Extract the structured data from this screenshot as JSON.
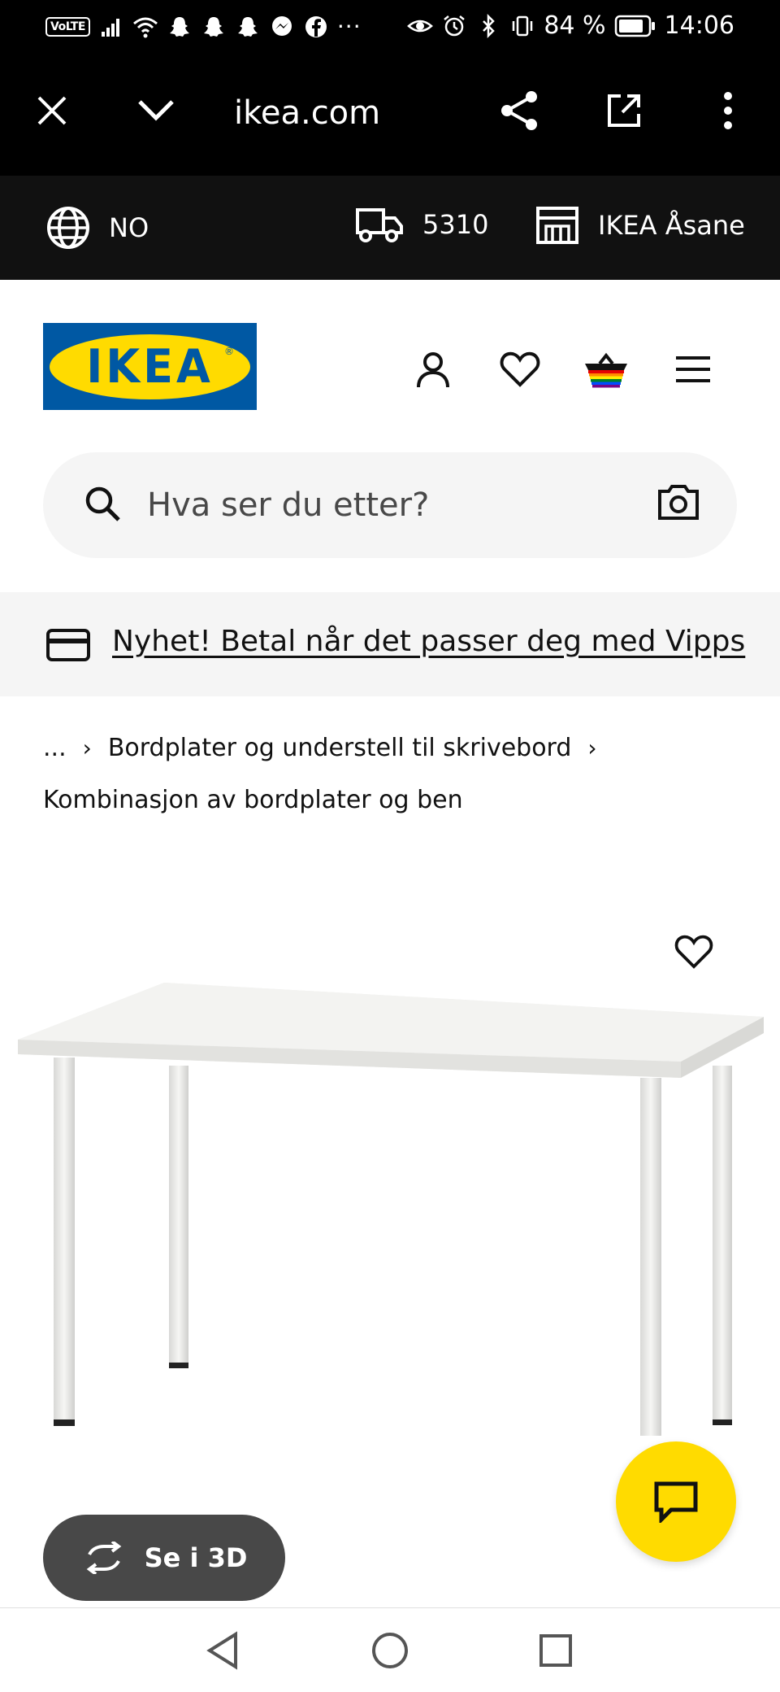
{
  "status_bar": {
    "carrier_badge": "VoLTE",
    "battery_percent": "84 %",
    "time": "14:06",
    "more_indicator": "···"
  },
  "browser": {
    "url": "ikea.com",
    "icons": [
      "close-icon",
      "chevron-down-icon",
      "share-icon",
      "open-external-icon",
      "more-vert-icon"
    ]
  },
  "locale_bar": {
    "country": "NO",
    "postcode": "5310",
    "store": "IKEA Åsane"
  },
  "header": {
    "logo_text": "IKEA",
    "logo_colors": {
      "blue": "#0058a3",
      "yellow": "#ffdb00"
    },
    "icons": [
      "account-icon",
      "favourites-icon",
      "cart-icon",
      "menu-icon"
    ]
  },
  "search": {
    "placeholder": "Hva ser du etter?"
  },
  "promo": {
    "text": "Nyhet! Betal når det passer deg med Vipps"
  },
  "breadcrumb": {
    "ellipsis": "...",
    "category": "Bordplater og understell til skrivebord",
    "current": "Kombinasjon av bordplater og ben"
  },
  "product": {
    "view_3d_label": "Se i 3D"
  },
  "colors": {
    "accent_yellow": "#ffdb00",
    "dark_bar": "#111111",
    "pill_grey": "#484848"
  }
}
